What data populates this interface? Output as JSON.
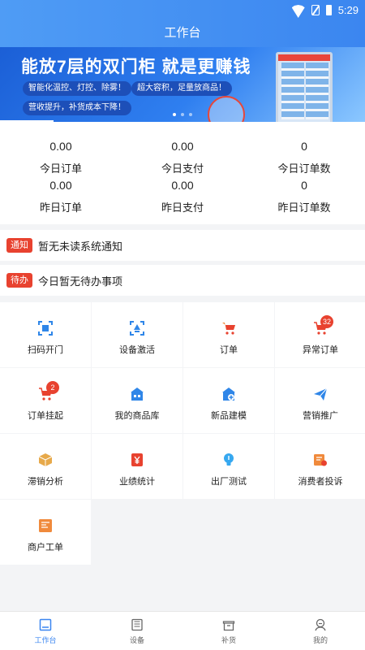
{
  "status_bar": {
    "time": "5:29"
  },
  "header": {
    "title": "工作台"
  },
  "banner": {
    "headline": "能放7层的双门柜  就是更赚钱",
    "pills": [
      "智能化温控、灯控、除雾！",
      "超大容积，足量放商品！",
      "营收提升，补货成本下降！"
    ],
    "slide_count": 3,
    "active_slide": 1
  },
  "stats": [
    {
      "value": "0.00",
      "label": "今日订单"
    },
    {
      "value": "0.00",
      "label": "今日支付"
    },
    {
      "value": "0",
      "label": "今日订单数"
    },
    {
      "value": "0.00",
      "label": "昨日订单"
    },
    {
      "value": "0.00",
      "label": "昨日支付"
    },
    {
      "value": "0",
      "label": "昨日订单数"
    }
  ],
  "notices": [
    {
      "tag": "通知",
      "text": "暂无未读系统通知"
    },
    {
      "tag": "待办",
      "text": "今日暂无待办事项"
    }
  ],
  "grid": [
    {
      "label": "扫码开门",
      "icon": "scan-icon"
    },
    {
      "label": "设备激活",
      "icon": "activate-icon"
    },
    {
      "label": "订单",
      "icon": "cart-icon"
    },
    {
      "label": "异常订单",
      "icon": "cart-alert-icon",
      "badge": "32"
    },
    {
      "label": "订单挂起",
      "icon": "cart-pause-icon",
      "badge": "2"
    },
    {
      "label": "我的商品库",
      "icon": "store-icon"
    },
    {
      "label": "新品建模",
      "icon": "new-product-icon"
    },
    {
      "label": "营销推广",
      "icon": "paper-plane-icon"
    },
    {
      "label": "滞销分析",
      "icon": "box-icon"
    },
    {
      "label": "业绩统计",
      "icon": "yen-icon"
    },
    {
      "label": "出厂测试",
      "icon": "bulb-icon"
    },
    {
      "label": "消费者投诉",
      "icon": "complaint-icon"
    },
    {
      "label": "商户工单",
      "icon": "work-order-icon"
    }
  ],
  "tabbar": [
    {
      "label": "工作台",
      "icon": "workbench-icon",
      "active": true
    },
    {
      "label": "设备",
      "icon": "device-icon"
    },
    {
      "label": "补货",
      "icon": "restock-icon"
    },
    {
      "label": "我的",
      "icon": "profile-icon"
    }
  ],
  "colors": {
    "primary": "#3b86f0",
    "accent_red": "#e8422f",
    "orange": "#f08a3c",
    "blue_icon": "#2f86e8",
    "background": "#f3f4f6"
  }
}
